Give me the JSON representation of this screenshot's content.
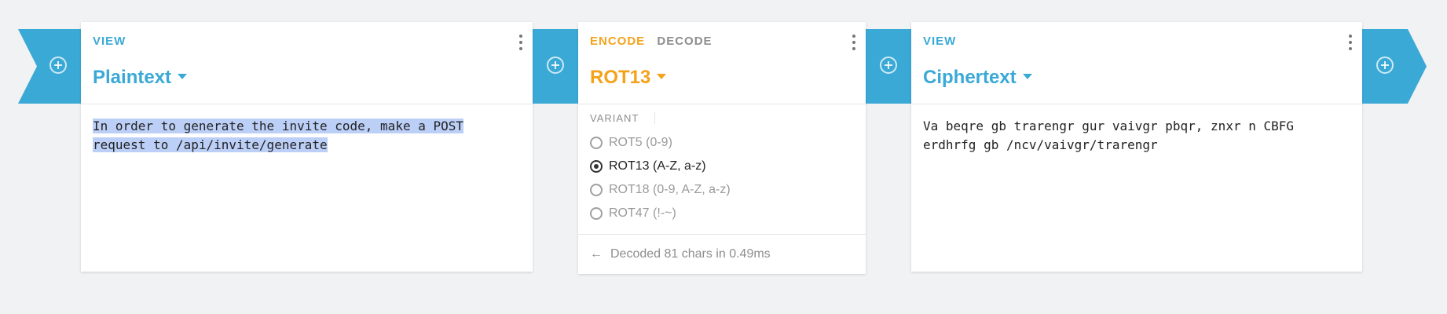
{
  "pipeline": {
    "add_buttons": [
      "add-step",
      "add-step",
      "add-step",
      "add-step"
    ]
  },
  "plaintext_card": {
    "mode": "VIEW",
    "title": "Plaintext",
    "content": "In order to generate the invite code, make a POST request to /api/invite/generate"
  },
  "rot13_card": {
    "modes": [
      "ENCODE",
      "DECODE"
    ],
    "active_mode": "ENCODE",
    "title": "ROT13",
    "variant_label": "VARIANT",
    "variants": [
      {
        "label": "ROT5 (0-9)",
        "selected": false
      },
      {
        "label": "ROT13 (A-Z, a-z)",
        "selected": true
      },
      {
        "label": "ROT18 (0-9, A-Z, a-z)",
        "selected": false
      },
      {
        "label": "ROT47 (!-~)",
        "selected": false
      }
    ],
    "status_arrow": "←",
    "status": "Decoded 81 chars in 0.49ms"
  },
  "ciphertext_card": {
    "mode": "VIEW",
    "title": "Ciphertext",
    "content": "Va beqre gb trarengr gur vaivgr pbqr, znxr n CBFG erdhrfg gb /ncv/vaivgr/trarengr"
  },
  "colors": {
    "accent_blue": "#3aa9d6",
    "accent_orange": "#f4a21b",
    "selection": "#bccff7"
  }
}
